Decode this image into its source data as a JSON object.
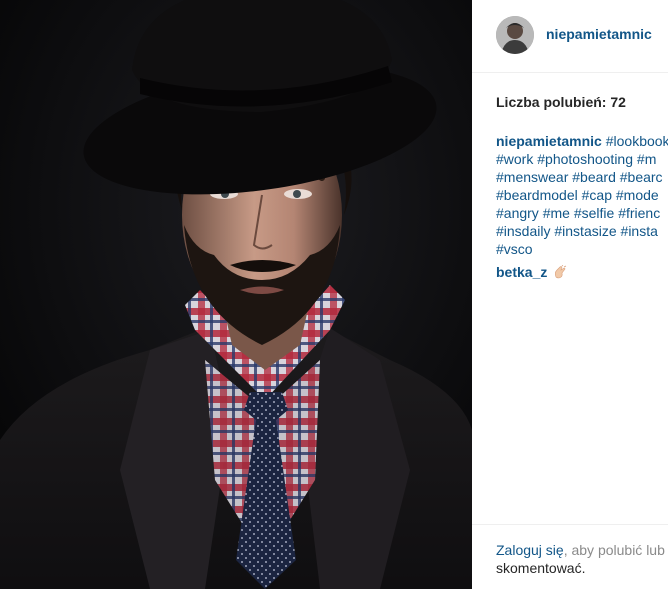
{
  "post": {
    "username": "niepamietamnic",
    "likes_label": "Liczba polubień: 72",
    "caption": {
      "username": "niepamietamnic",
      "lines": [
        [
          "#lookbook"
        ],
        [
          "#work",
          "#photoshooting",
          "#m"
        ],
        [
          "#menswear",
          "#beard",
          "#bearc"
        ],
        [
          "#beardmodel",
          "#cap",
          "#mode"
        ],
        [
          "#angry",
          "#me",
          "#selfie",
          "#frienc"
        ],
        [
          "#insdaily",
          "#instasize",
          "#insta"
        ],
        [
          "#vsco"
        ]
      ]
    },
    "comments": [
      {
        "username": "betka_z",
        "emoji": "clapping-hands-icon"
      }
    ]
  },
  "footer": {
    "login_link": "Zaloguj się",
    "login_text_rest": ", aby polubić lub",
    "login_text_line2": "skomentować."
  },
  "colors": {
    "link": "#125688",
    "text": "#262626",
    "border": "#efefef",
    "photo_background": "#0c0c0e"
  }
}
